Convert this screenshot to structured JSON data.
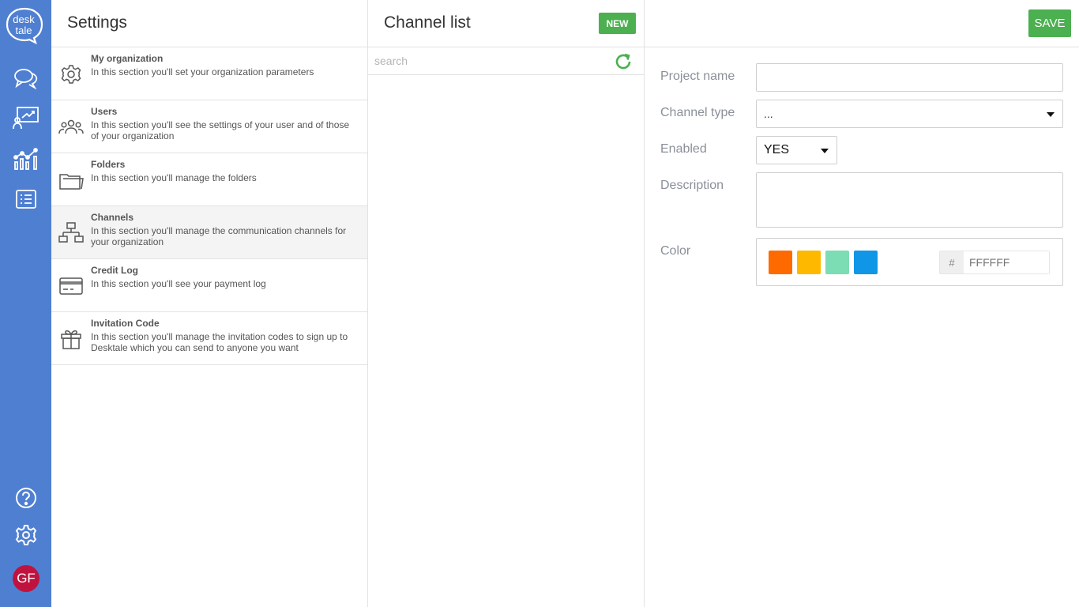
{
  "rail": {
    "logo_line1": "desk",
    "logo_line2": "tale",
    "avatar_initials": "GF",
    "colors": {
      "background": "#4f7fd1",
      "avatar": "#c0123f"
    },
    "icons": [
      "chat-icon",
      "presentation-icon",
      "analytics-icon",
      "list-icon",
      "help-icon",
      "settings-icon"
    ]
  },
  "settings": {
    "title": "Settings",
    "items": [
      {
        "icon": "gear-icon",
        "title": "My organization",
        "description": "In this section you'll set your organization parameters"
      },
      {
        "icon": "users-icon",
        "title": "Users",
        "description": "In this section you'll see the settings of your user and of those of your organization"
      },
      {
        "icon": "folder-icon",
        "title": "Folders",
        "description": "In this section you'll manage the folders"
      },
      {
        "icon": "network-icon",
        "title": "Channels",
        "description": "In this section you'll manage the communication channels for your organization",
        "active": true
      },
      {
        "icon": "credit-card-icon",
        "title": "Credit Log",
        "description": "In this section you'll see your payment log"
      },
      {
        "icon": "gift-icon",
        "title": "Invitation Code",
        "description": "In this section you'll manage the invitation codes to sign up to Desktale which you can send to anyone you want"
      }
    ]
  },
  "channel_list": {
    "title": "Channel list",
    "new_label": "NEW",
    "search_placeholder": "search"
  },
  "detail": {
    "save_label": "SAVE",
    "project_name_label": "Project name",
    "project_name_value": "",
    "channel_type_label": "Channel type",
    "channel_type_value": "...",
    "enabled_label": "Enabled",
    "enabled_value": "YES",
    "description_label": "Description",
    "description_value": "",
    "color_label": "Color",
    "swatches": [
      "#ff6a00",
      "#ffb800",
      "#7cdcb4",
      "#0f96e6"
    ],
    "hash_symbol": "#",
    "hex_placeholder": "FFFFFF",
    "accent_color": "#4caf50"
  }
}
